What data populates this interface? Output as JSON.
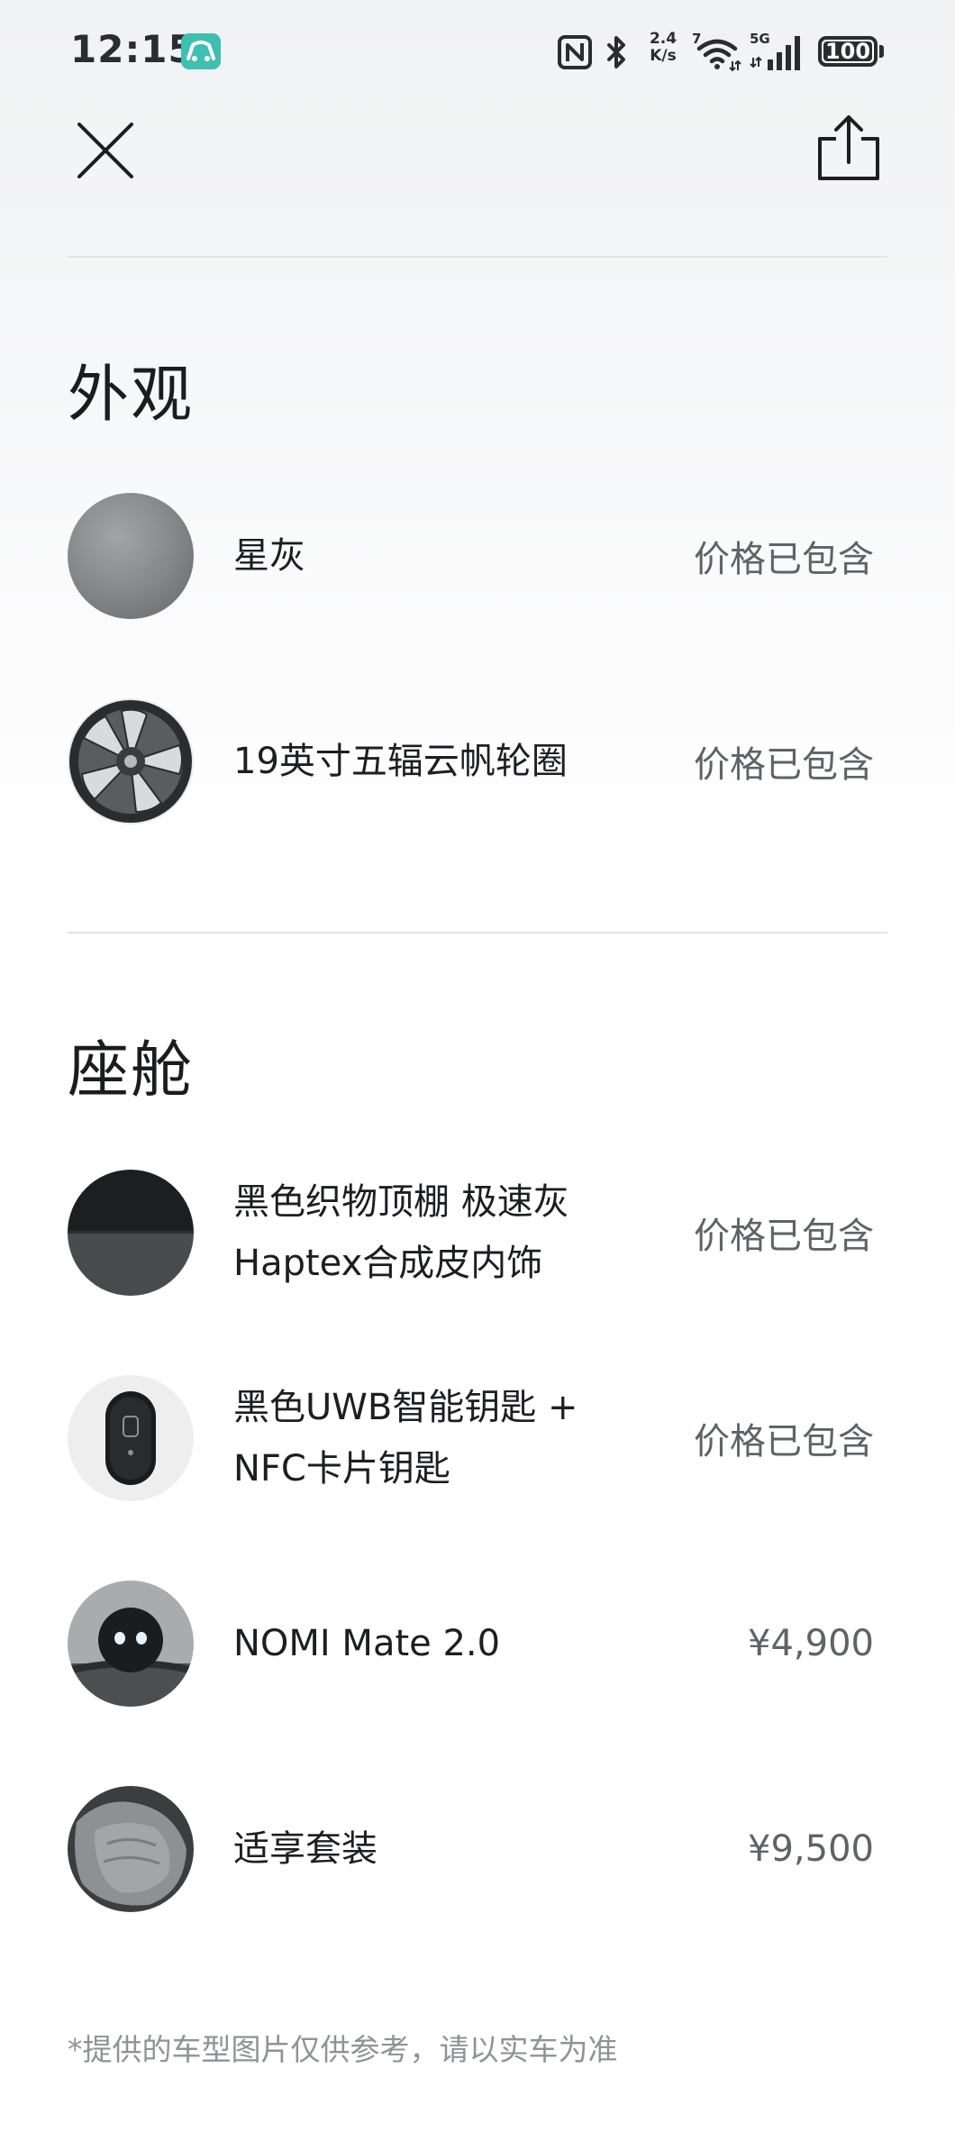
{
  "status_bar": {
    "time": "12:15",
    "net_speed_value": "2.4",
    "net_speed_unit": "K/s",
    "battery": "100",
    "icons": [
      "app-logo-icon",
      "nfc-icon",
      "bluetooth-icon",
      "wifi-icon",
      "signal-5g-icon",
      "battery-icon"
    ]
  },
  "header": {
    "close_icon": "close-icon",
    "share_icon": "share-icon"
  },
  "sections": [
    {
      "title": "外观",
      "items": [
        {
          "name": "星灰",
          "price": "价格已包含",
          "thumb": "gray-paint-swatch"
        },
        {
          "name": "19英寸五辐云帆轮圈",
          "price": "价格已包含",
          "thumb": "wheel-rim"
        }
      ]
    },
    {
      "title": "座舱",
      "items": [
        {
          "name_line1": "黑色织物顶棚 极速灰",
          "name_line2": "Haptex合成皮内饰",
          "price": "价格已包含",
          "thumb": "interior-swatch"
        },
        {
          "name_line1": "黑色UWB智能钥匙 +",
          "name_line2": "NFC卡片钥匙",
          "price": "价格已包含",
          "thumb": "smart-key"
        },
        {
          "name": "NOMI Mate 2.0",
          "price": "¥4,900",
          "thumb": "nomi-mate"
        },
        {
          "name": "适享套装",
          "price": "¥9,500",
          "thumb": "comfort-seat"
        }
      ]
    }
  ],
  "disclaimer": "*提供的车型图片仅供参考，请以实车为准",
  "colors": {
    "text_primary": "#1b1d22",
    "text_secondary": "#5f6368",
    "disclaimer": "#8f9297",
    "divider": "#e4e6e9",
    "app_logo_teal": "#3fbfb2"
  }
}
